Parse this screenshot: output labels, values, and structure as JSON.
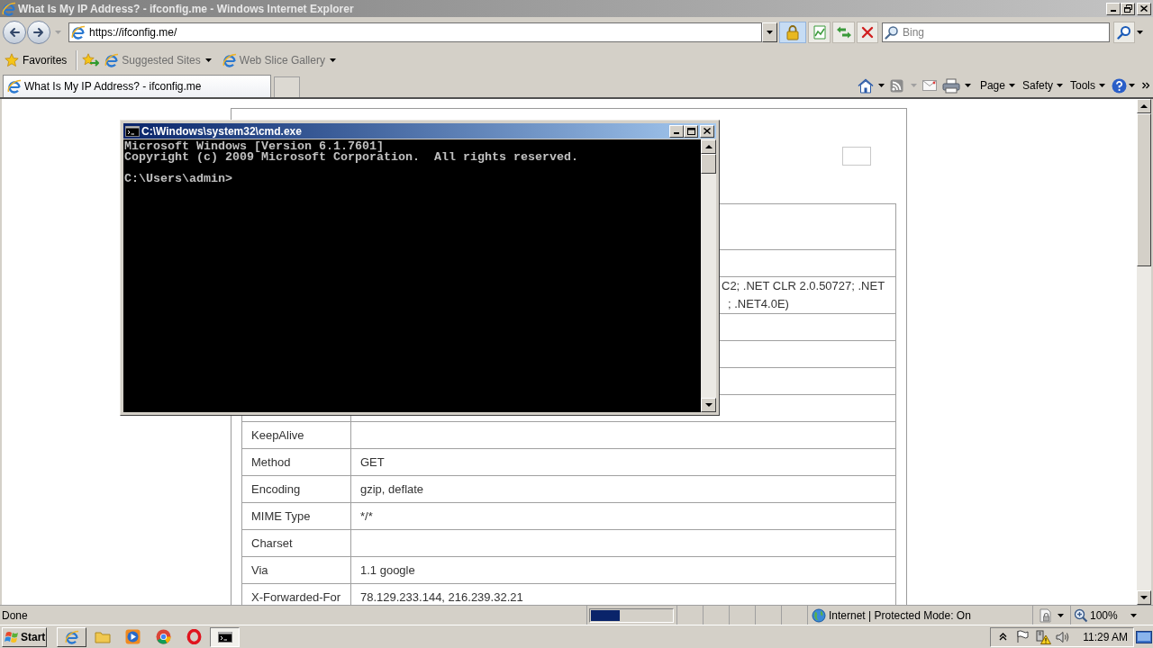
{
  "window": {
    "title": "What Is My IP Address? - ifconfig.me - Windows Internet Explorer"
  },
  "address_bar": {
    "value": "https://ifconfig.me/"
  },
  "search": {
    "placeholder": "Bing"
  },
  "favorites_bar": {
    "label": "Favorites",
    "items": [
      {
        "label": "Suggested Sites",
        "disabled": true
      },
      {
        "label": "Web Slice Gallery",
        "disabled": true
      }
    ]
  },
  "tabs": [
    {
      "label": "What Is My IP Address? - ifconfig.me",
      "selected": true
    }
  ],
  "command_bar": {
    "buttons": [
      {
        "kind": "home",
        "disabled": false
      },
      {
        "kind": "feeds",
        "disabled": true
      },
      {
        "kind": "mail",
        "disabled": false
      },
      {
        "kind": "print",
        "disabled": false
      }
    ],
    "menus": [
      "Page",
      "Safety",
      "Tools"
    ]
  },
  "page": {
    "table": {
      "rows": [
        {
          "kind": "covered"
        },
        {
          "kind": "covered"
        },
        {
          "kind": "partial",
          "column_2_lines": [
            "C2; .NET CLR 2.0.50727; .NET",
            "; .NET4.0E)"
          ]
        },
        {
          "kind": "covered"
        },
        {
          "kind": "covered"
        },
        {
          "kind": "covered"
        },
        {
          "kind": "covered"
        },
        {
          "kind": "field",
          "column_1": "KeepAlive"
        },
        {
          "kind": "field",
          "column_1": "Method",
          "column_2": "GET"
        },
        {
          "kind": "field",
          "column_1": "Encoding",
          "column_2": "gzip, deflate"
        },
        {
          "kind": "field",
          "column_1": "MIME Type",
          "column_2": "*/*"
        },
        {
          "kind": "field",
          "column_1": "Charset"
        },
        {
          "kind": "field",
          "column_1": "Via",
          "column_2": "1.1 google"
        },
        {
          "kind": "field",
          "column_1": "X-Forwarded-For",
          "column_2": "78.129.233.144, 216.239.32.21"
        }
      ]
    }
  },
  "console_window": {
    "title": "C:\\Windows\\system32\\cmd.exe",
    "lines": [
      "Microsoft Windows [Version 6.1.7601]",
      "Copyright (c) 2009 Microsoft Corporation.  All rights reserved."
    ],
    "prompt": "C:\\Users\\admin>"
  },
  "status_bar": {
    "text": "Done",
    "progress": {
      "level": 0.35
    },
    "zone": "Internet | Protected Mode: On",
    "zoom": "100%"
  },
  "taskbar": {
    "start": "Start",
    "items": [
      {
        "kind": "browser",
        "running": true,
        "selected": false
      },
      {
        "kind": "folder",
        "running": false,
        "selected": false
      },
      {
        "kind": "player",
        "running": false,
        "selected": false
      },
      {
        "kind": "wheel",
        "running": false,
        "selected": false
      },
      {
        "kind": "ring",
        "running": false,
        "selected": false
      },
      {
        "kind": "console",
        "running": true,
        "selected": true
      }
    ],
    "clock": "11:29 AM"
  }
}
